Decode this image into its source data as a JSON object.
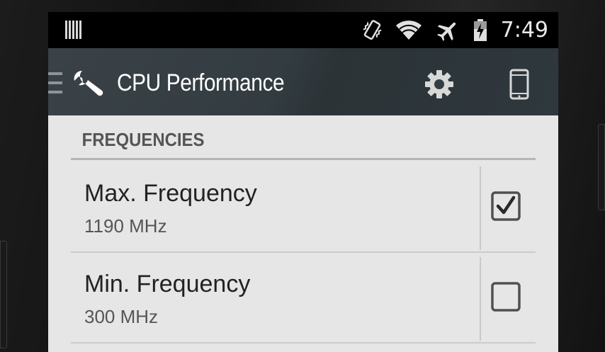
{
  "status_bar": {
    "time": "7:49",
    "icons": [
      "barcode-icon",
      "vibrate-icon",
      "wifi-icon",
      "airplane-mode-icon",
      "battery-charging-icon"
    ]
  },
  "action_bar": {
    "title": "CPU Performance",
    "icons": [
      "drawer-indicator-icon",
      "wrench-icon",
      "gear-icon",
      "phone-icon"
    ]
  },
  "section": {
    "title": "FREQUENCIES"
  },
  "preferences": [
    {
      "title": "Max. Frequency",
      "summary": "1190 MHz",
      "checked": true
    },
    {
      "title": "Min. Frequency",
      "summary": "300 MHz",
      "checked": false
    }
  ],
  "colors": {
    "action_bar": "#343d42",
    "status_bar": "#000000",
    "background": "#e6e6e6",
    "section_text": "#555555"
  }
}
